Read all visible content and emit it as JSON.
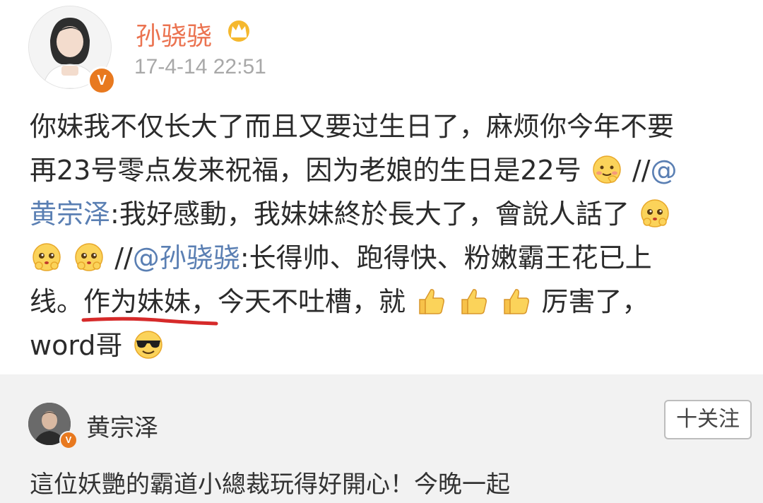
{
  "post": {
    "username": "孙骁骁",
    "timestamp": "17-4-14 22:51",
    "icons": {
      "crown": "crown-icon",
      "verified": "verified-badge-icon"
    },
    "badge_letter": "V",
    "body_lines": {
      "l1": "你妹我不仅长大了而且又要过生日了，麻烦你今年不要",
      "l2a": "再23号零点发来祝福，因为老娘的生日是22号",
      "l2b": " //",
      "l2c": "@",
      "l3a": "黄宗泽",
      "l3b": ":我好感動，我妹妹終於長大了，會說人話了",
      "l4a": " //",
      "l4b": "@孙骁骁",
      "l4c": ":长得帅、跑得快、粉嫩霸王花已上",
      "l5a": "线。",
      "l5b": "作为妹妹",
      "l5c": "，今天不吐槽，就",
      "l5d": "厉害了，",
      "l6": "word哥"
    }
  },
  "repost": {
    "username": "黄宗泽",
    "follow_label": "十关注",
    "text": "這位妖艷的霸道小總裁玩得好開心！今晚一起"
  },
  "colors": {
    "username": "#eb7350",
    "mention": "#5a7fb3",
    "badge": "#e8791f",
    "underline": "#d62a2a"
  }
}
